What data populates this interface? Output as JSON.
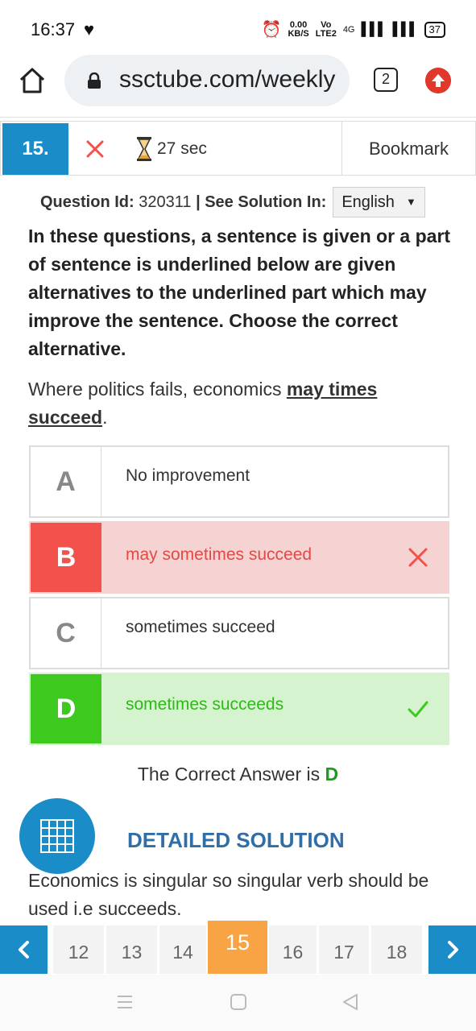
{
  "status_bar": {
    "time": "16:37",
    "speed_top": "0.00",
    "speed_bottom": "KB/S",
    "volte_top": "Vo",
    "volte_bottom": "LTE2",
    "network": "4G",
    "battery": "37"
  },
  "browser": {
    "url": "ssctube.com/weekly",
    "tab_count": "2"
  },
  "question_header": {
    "number": "15.",
    "timer": "27 sec",
    "bookmark_label": "Bookmark"
  },
  "meta": {
    "id_label": "Question Id:",
    "id_value": "320311",
    "solution_label": "| See Solution In:",
    "language": "English"
  },
  "question": {
    "prompt": "In these questions, a sentence is given or a part of sentence is underlined below are given alternatives to the underlined part which may improve the sentence. Choose the correct alternative.",
    "sentence_before": "Where politics fails, economics ",
    "sentence_underlined": "may times succeed",
    "sentence_after": "."
  },
  "options": [
    {
      "letter": "A",
      "text": "No improvement",
      "state": "neutral"
    },
    {
      "letter": "B",
      "text": "may sometimes succeed",
      "state": "wrong"
    },
    {
      "letter": "C",
      "text": "sometimes succeed",
      "state": "neutral"
    },
    {
      "letter": "D",
      "text": "sometimes succeeds",
      "state": "correct"
    }
  ],
  "answer": {
    "label": "The Correct Answer is ",
    "value": "D"
  },
  "solution": {
    "title": "DETAILED SOLUTION",
    "text": "Economics is singular so singular verb should be used i.e succeeds."
  },
  "pagination": {
    "pages": [
      "12",
      "13",
      "14",
      "15",
      "16",
      "17",
      "18"
    ],
    "active": "15"
  },
  "colors": {
    "primary": "#1a8cc8",
    "wrong": "#f2514c",
    "correct": "#3ec91e",
    "active_page": "#f9a444"
  }
}
